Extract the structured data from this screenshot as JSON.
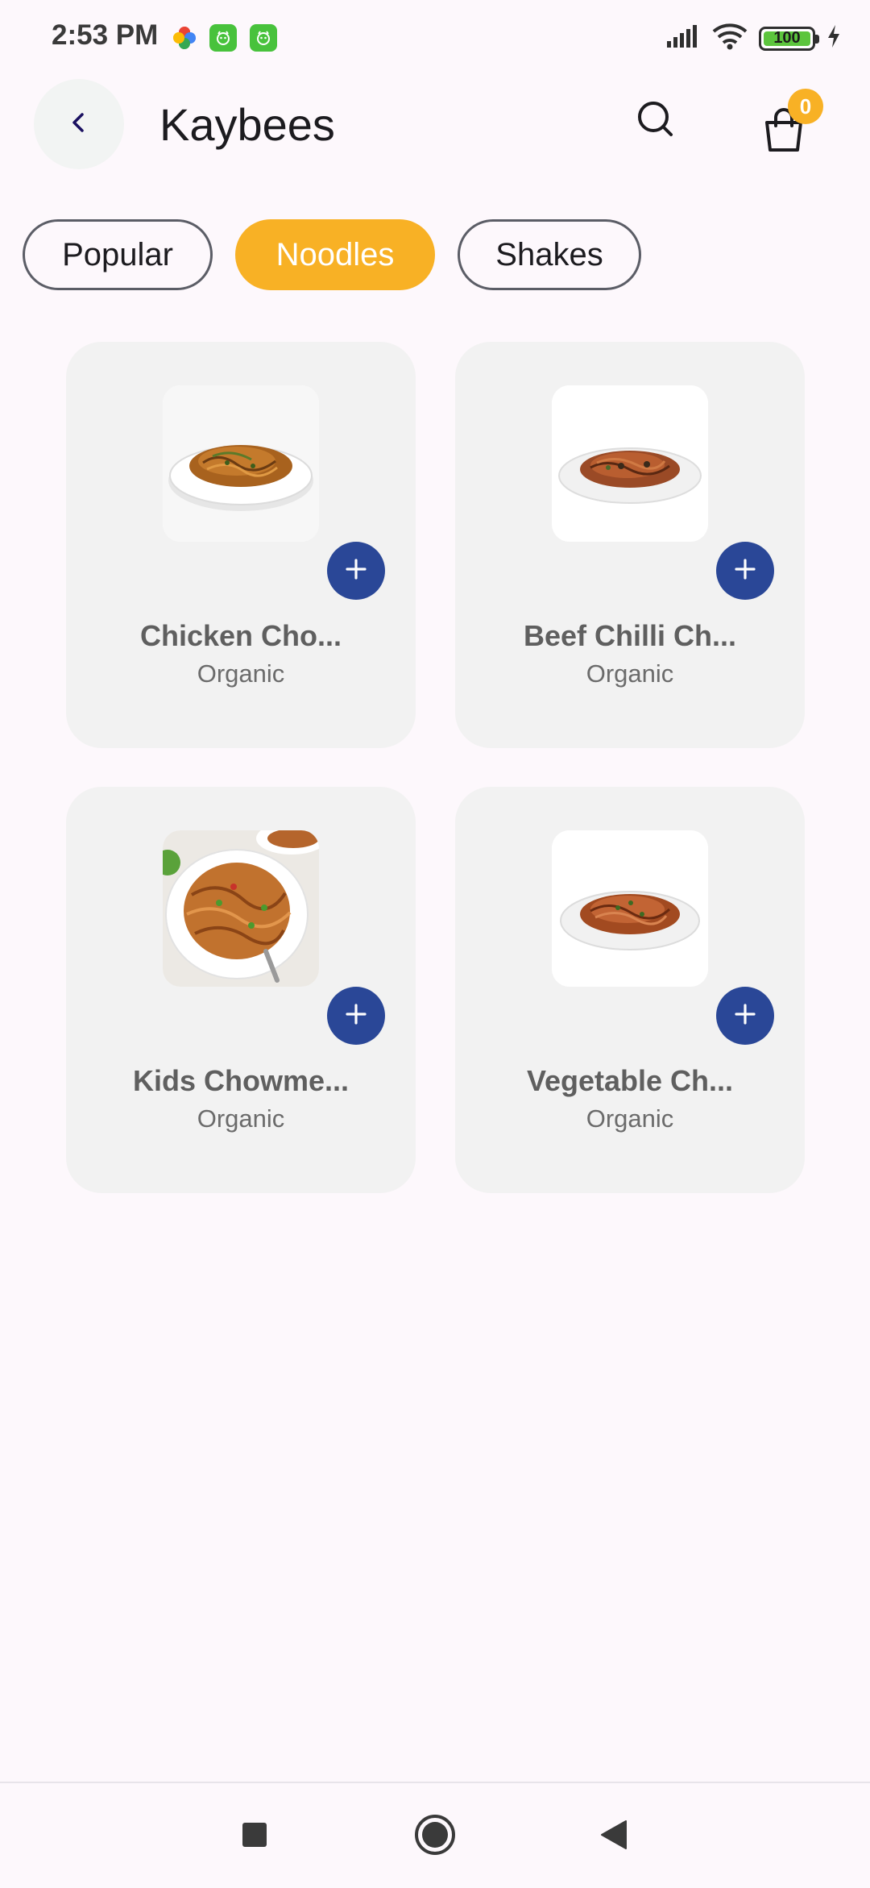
{
  "status_bar": {
    "time": "2:53 PM",
    "battery": "100",
    "icons": [
      "google-photos-icon",
      "app-notification-icon",
      "app-notification-icon",
      "signal-icon",
      "wifi-icon",
      "battery-icon",
      "charging-icon"
    ]
  },
  "header": {
    "title": "Kaybees",
    "cart_count": "0",
    "icons": [
      "back-arrow-icon",
      "search-icon",
      "shopping-bag-icon"
    ]
  },
  "categories": [
    {
      "label": "Popular",
      "active": false
    },
    {
      "label": "Noodles",
      "active": true
    },
    {
      "label": "Shakes",
      "active": false
    }
  ],
  "products": [
    {
      "name": "Chicken Cho...",
      "subtitle": "Organic"
    },
    {
      "name": "Beef Chilli Ch...",
      "subtitle": "Organic"
    },
    {
      "name": "Kids Chowme...",
      "subtitle": "Organic"
    },
    {
      "name": "Vegetable Ch...",
      "subtitle": "Organic"
    }
  ],
  "nav_bar": {
    "icons": [
      "recents-square-icon",
      "home-circle-icon",
      "back-triangle-icon"
    ]
  },
  "colors": {
    "accent": "#f8b125",
    "add_button": "#2a4797",
    "card_background": "#f2f2f2",
    "page_background": "#fdf8fc"
  }
}
